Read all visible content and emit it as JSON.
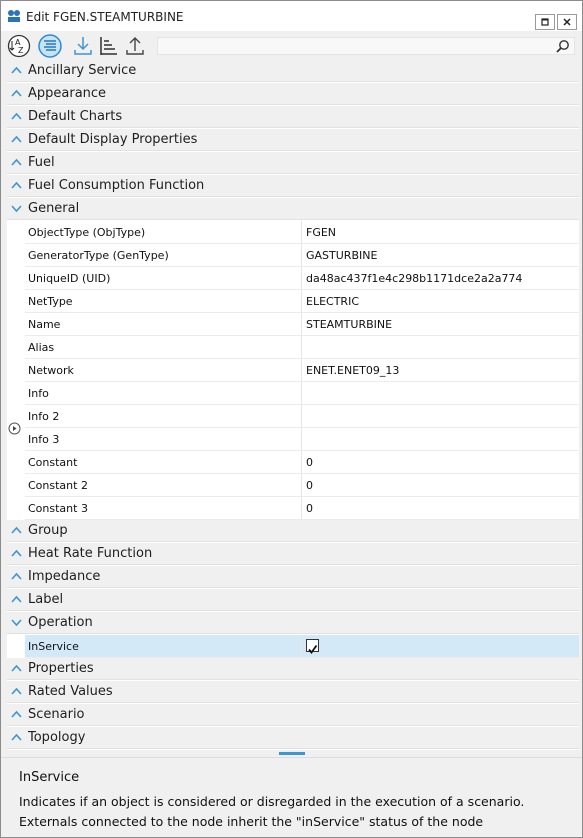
{
  "window": {
    "title": "Edit FGEN.STEAMTURBINE",
    "icon": "app-icon"
  },
  "window_buttons": [
    {
      "name": "restore-icon"
    },
    {
      "name": "close-icon"
    }
  ],
  "toolbar": {
    "buttons": [
      {
        "name": "sort-alphabetical-icon"
      },
      {
        "name": "categorized-view-icon",
        "active": true
      },
      {
        "name": "import-icon"
      },
      {
        "name": "hierarchy-icon"
      },
      {
        "name": "export-icon"
      }
    ],
    "search_value": "",
    "search_icon": "search-icon"
  },
  "categories_top": [
    "Ancillary Service",
    "Appearance",
    "Default Charts",
    "Default Display Properties",
    "Fuel",
    "Fuel Consumption Function",
    "General"
  ],
  "general_properties": [
    {
      "name": "ObjectType (ObjType)",
      "value": "FGEN"
    },
    {
      "name": "GeneratorType (GenType)",
      "value": "GASTURBINE"
    },
    {
      "name": "UniqueID (UID)",
      "value": "da48ac437f1e4c298b1171dce2a2a774"
    },
    {
      "name": "NetType",
      "value": "ELECTRIC"
    },
    {
      "name": "Name",
      "value": "STEAMTURBINE"
    },
    {
      "name": "Alias",
      "value": ""
    },
    {
      "name": "Network",
      "value": "ENET.ENET09_13"
    },
    {
      "name": "Info",
      "value": ""
    },
    {
      "name": "Info 2",
      "value": ""
    },
    {
      "name": "Info 3",
      "value": ""
    },
    {
      "name": "Constant",
      "value": "0"
    },
    {
      "name": "Constant 2",
      "value": "0"
    },
    {
      "name": "Constant 3",
      "value": "0"
    }
  ],
  "categories_mid": [
    "Group",
    "Heat Rate Function",
    "Impedance",
    "Label",
    "Operation"
  ],
  "operation_properties": [
    {
      "name": "InService",
      "checked": true
    }
  ],
  "categories_bottom": [
    "Properties",
    "Rated Values",
    "Scenario",
    "Topology"
  ],
  "description": {
    "title": "InService",
    "text": "Indicates if an object is considered or disregarded in the execution of a scenario. Externals connected to the node inherit the \"inService\" status of the node"
  },
  "colors": {
    "accent": "#3c96d6",
    "selection": "#d4e9f7",
    "category_bg": "#f0f0f0"
  }
}
